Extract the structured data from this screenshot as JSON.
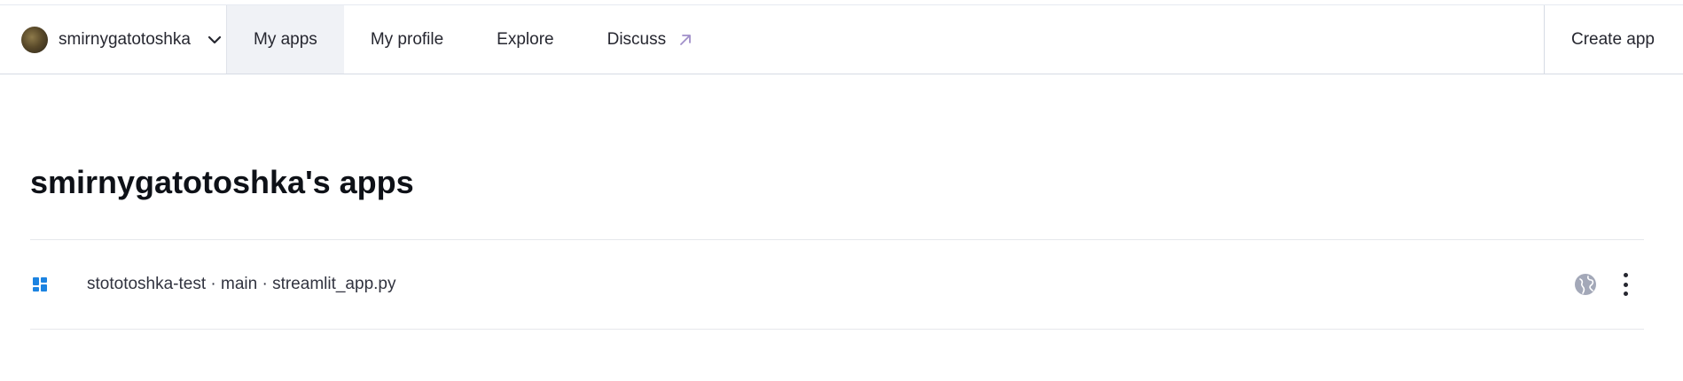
{
  "header": {
    "account_name": "smirnygatotoshka",
    "tabs": [
      {
        "label": "My apps",
        "active": true
      },
      {
        "label": "My profile",
        "active": false
      },
      {
        "label": "Explore",
        "active": false
      },
      {
        "label": "Discuss",
        "active": false,
        "external": true
      }
    ],
    "create_app_label": "Create app"
  },
  "main": {
    "title": "smirnygatotoshka's apps",
    "apps": [
      {
        "label": "stototoshka-test · main · streamlit_app.py",
        "icon": "streamlit-app-icon",
        "visibility_icon": "globe-icon"
      }
    ]
  },
  "colors": {
    "active_tab_bg": "#f0f2f6",
    "app_icon": "#1c83e1",
    "globe_icon": "#a3a8b8",
    "external_arrow": "#a08fc9",
    "text": "#262730"
  }
}
